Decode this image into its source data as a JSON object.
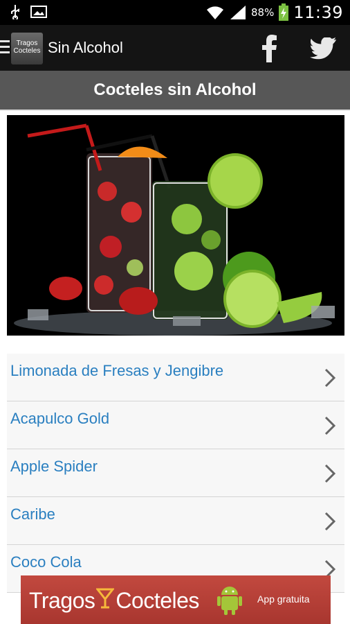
{
  "status_bar": {
    "battery": "88%",
    "time": "11:39"
  },
  "app_bar": {
    "logo_text": "Tragos Cocteles",
    "title": "Sin Alcohol"
  },
  "section": {
    "title": "Cocteles sin Alcohol"
  },
  "drinks": [
    "Limonada de Fresas y Jengibre",
    "Acapulco Gold",
    "Apple Spider",
    "Caribe",
    "Coco Cola"
  ],
  "ad": {
    "brand_left": "Tragos",
    "brand_right": "Cocteles",
    "tagline": "App gratuita"
  },
  "colors": {
    "link": "#2a7fc0",
    "header_bg": "#575757",
    "actionbar_bg": "#141414",
    "ad_bg": "#b13e35"
  }
}
